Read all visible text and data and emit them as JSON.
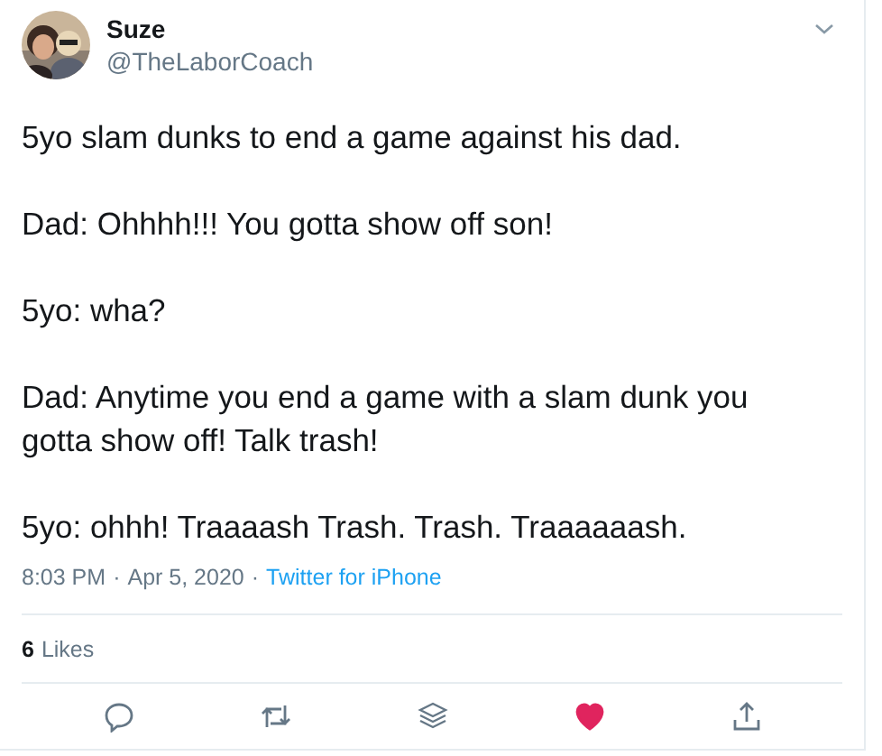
{
  "author": {
    "name": "Suze",
    "handle": "@TheLaborCoach"
  },
  "paragraphs": [
    "5yo slam dunks to end a game against his dad.",
    "Dad: Ohhhh!!! You gotta show off son!",
    "5yo: wha?",
    "Dad: Anytime you end a game with a slam dunk you gotta show off! Talk trash!",
    "5yo: ohhh! Traaaash Trash. Trash. Traaaaaash."
  ],
  "meta": {
    "time": "8:03 PM",
    "date": "Apr 5, 2020",
    "source": "Twitter for iPhone",
    "separator": "·"
  },
  "likes": {
    "count": "6",
    "label": "Likes"
  },
  "actions": [
    {
      "kind": "reply"
    },
    {
      "kind": "retweet"
    },
    {
      "kind": "stack"
    },
    {
      "kind": "like",
      "selected": true
    },
    {
      "kind": "share"
    }
  ]
}
